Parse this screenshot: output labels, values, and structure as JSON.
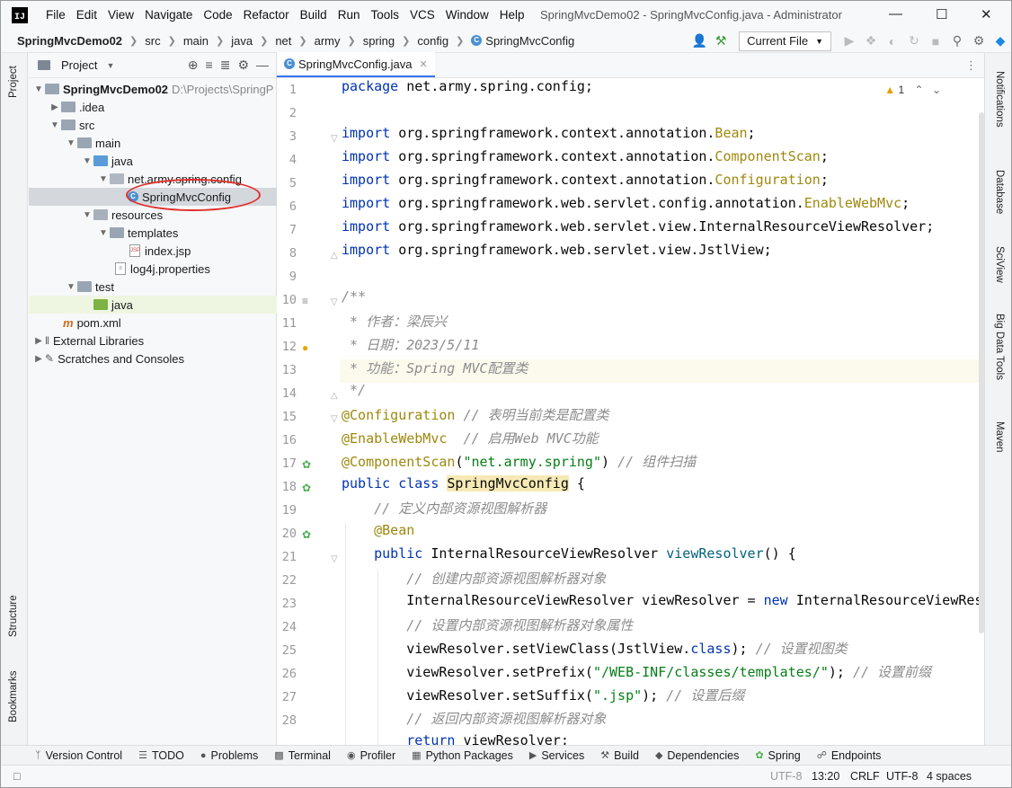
{
  "window": {
    "title": "SpringMvcDemo02 - SpringMvcConfig.java - Administrator",
    "logo_text": "IJ"
  },
  "menu": [
    "File",
    "Edit",
    "View",
    "Navigate",
    "Code",
    "Refactor",
    "Build",
    "Run",
    "Tools",
    "VCS",
    "Window",
    "Help"
  ],
  "breadcrumb": [
    "SpringMvcDemo02",
    "src",
    "main",
    "java",
    "net",
    "army",
    "spring",
    "config",
    "SpringMvcConfig"
  ],
  "toolbar": {
    "run_config": "Current File"
  },
  "project_panel": {
    "title": "Project",
    "tree": [
      {
        "label": "SpringMvcDemo02",
        "extra": "D:\\Projects\\SpringP",
        "depth": 0,
        "arrow": "open",
        "icon": "folder",
        "bold": true
      },
      {
        "label": ".idea",
        "depth": 1,
        "arrow": "closed",
        "icon": "folder"
      },
      {
        "label": "src",
        "depth": 1,
        "arrow": "open",
        "icon": "folder"
      },
      {
        "label": "main",
        "depth": 2,
        "arrow": "open",
        "icon": "folder"
      },
      {
        "label": "java",
        "depth": 3,
        "arrow": "open",
        "icon": "folder-blue"
      },
      {
        "label": "net.army.spring.config",
        "depth": 4,
        "arrow": "open",
        "icon": "package"
      },
      {
        "label": "SpringMvcConfig",
        "depth": 5,
        "arrow": "none",
        "icon": "class",
        "selected": true
      },
      {
        "label": "resources",
        "depth": 3,
        "arrow": "open",
        "icon": "folder-res"
      },
      {
        "label": "templates",
        "depth": 4,
        "arrow": "open",
        "icon": "folder"
      },
      {
        "label": "index.jsp",
        "depth": 5,
        "arrow": "none",
        "icon": "jsp"
      },
      {
        "label": "log4j.properties",
        "depth": 4,
        "arrow": "none",
        "icon": "props"
      },
      {
        "label": "test",
        "depth": 2,
        "arrow": "open",
        "icon": "folder"
      },
      {
        "label": "java",
        "depth": 3,
        "arrow": "none",
        "icon": "folder-green",
        "highlight": true
      },
      {
        "label": "pom.xml",
        "depth": 2,
        "arrow": "none",
        "icon": "maven"
      },
      {
        "label": "External Libraries",
        "depth": 0,
        "arrow": "closed",
        "icon": "lib"
      },
      {
        "label": "Scratches and Consoles",
        "depth": 0,
        "arrow": "closed",
        "icon": "scratch"
      }
    ]
  },
  "editor": {
    "tab_label": "SpringMvcConfig.java",
    "warning_count": "1",
    "line_numbers": [
      "1",
      "2",
      "3",
      "4",
      "5",
      "6",
      "7",
      "8",
      "9",
      "10",
      "11",
      "12",
      "13",
      "14",
      "15",
      "16",
      "17",
      "18",
      "19",
      "20",
      "21",
      "22",
      "23",
      "24",
      "25",
      "26",
      "27",
      "28"
    ]
  },
  "left_stripe": [
    "Project",
    "Structure",
    "Bookmarks"
  ],
  "right_stripe": [
    "Notifications",
    "Database",
    "SciView",
    "Big Data Tools",
    "Maven"
  ],
  "bottom_tools": [
    "Version Control",
    "TODO",
    "Problems",
    "Terminal",
    "Profiler",
    "Python Packages",
    "Services",
    "Build",
    "Dependencies",
    "Spring",
    "Endpoints"
  ],
  "status": {
    "encoding_left": "UTF-8",
    "position": "13:20",
    "line_sep": "CRLF",
    "encoding": "UTF-8",
    "indent": "4 spaces"
  }
}
